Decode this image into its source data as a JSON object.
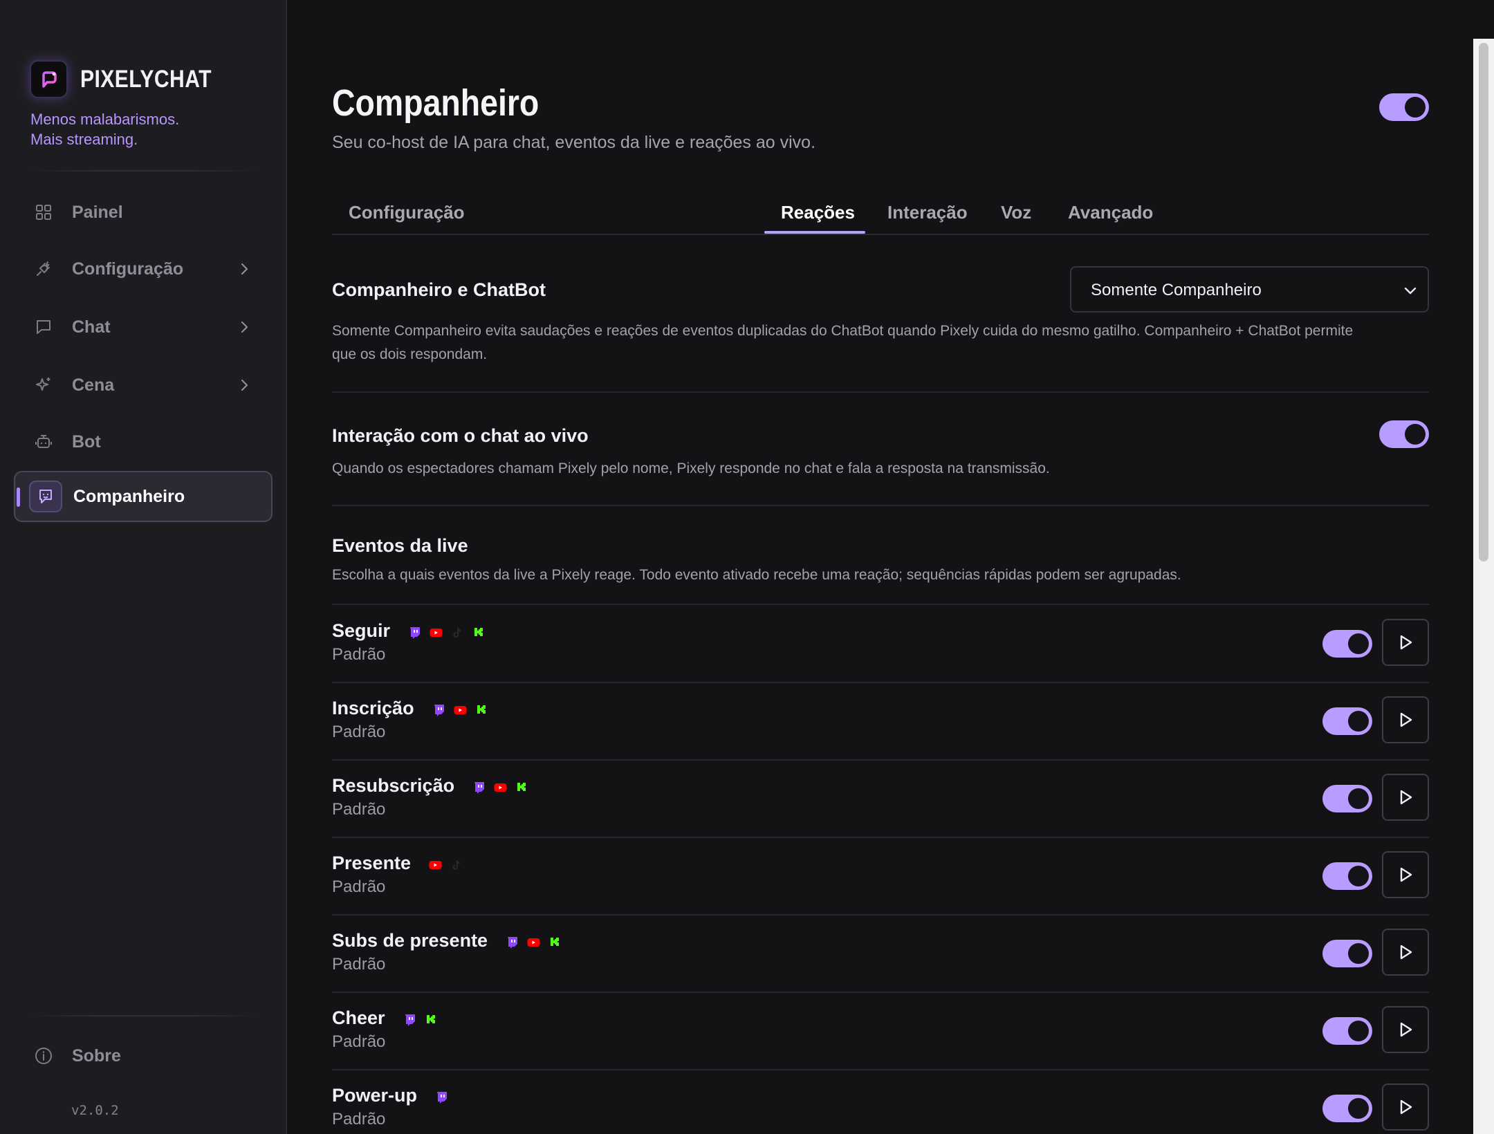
{
  "sidebar": {
    "brand": "PIXELYCHAT",
    "tagline_line1": "Menos malabarismos.",
    "tagline_line2": "Mais streaming.",
    "items": [
      {
        "label": "Painel",
        "icon": "grid-icon"
      },
      {
        "label": "Configuração",
        "icon": "plug-icon"
      },
      {
        "label": "Chat",
        "icon": "chat-bubble-icon"
      },
      {
        "label": "Cena",
        "icon": "sparkle-icon"
      },
      {
        "label": "Bot",
        "icon": "robot-icon"
      },
      {
        "label": "Companheiro",
        "icon": "companion-icon"
      }
    ],
    "about_label": "Sobre",
    "version": "v2.0.2"
  },
  "page": {
    "title": "Companheiro",
    "subtitle": "Seu co-host de IA para chat, eventos da live e reações ao vivo.",
    "enabled": true
  },
  "tabs": [
    "Configuração",
    "Reações",
    "Interação",
    "Voz",
    "Avançado"
  ],
  "active_tab": "Reações",
  "sections": {
    "companion_chatbot": {
      "title": "Companheiro e ChatBot",
      "select_value": "Somente Companheiro",
      "desc_line1": "Somente Companheiro evita saudações e reações de eventos duplicadas do ChatBot quando Pixely cuida do mesmo gatilho. Companheiro + ChatBot permite",
      "desc_line2": "que os dois respondam."
    },
    "live_chat": {
      "title": "Interação com o chat ao vivo",
      "desc": "Quando os espectadores chamam Pixely pelo nome, Pixely responde no chat e fala a resposta na transmissão.",
      "enabled": true
    },
    "live_events": {
      "title": "Eventos da live",
      "desc": "Escolha a quais eventos da live a Pixely reage. Todo evento ativado recebe uma reação; sequências rápidas podem ser agrupadas."
    }
  },
  "events": [
    {
      "name": "Seguir",
      "sub": "Padrão",
      "platforms": [
        "twitch",
        "youtube",
        "tiktok",
        "kick"
      ],
      "enabled": true
    },
    {
      "name": "Inscrição",
      "sub": "Padrão",
      "platforms": [
        "twitch",
        "youtube",
        "kick"
      ],
      "enabled": true
    },
    {
      "name": "Resubscrição",
      "sub": "Padrão",
      "platforms": [
        "twitch",
        "youtube",
        "kick"
      ],
      "enabled": true
    },
    {
      "name": "Presente",
      "sub": "Padrão",
      "platforms": [
        "youtube",
        "tiktok"
      ],
      "enabled": true
    },
    {
      "name": "Subs de presente",
      "sub": "Padrão",
      "platforms": [
        "twitch",
        "youtube",
        "kick"
      ],
      "enabled": true
    },
    {
      "name": "Cheer",
      "sub": "Padrão",
      "platforms": [
        "twitch",
        "kick"
      ],
      "enabled": true
    },
    {
      "name": "Power-up",
      "sub": "Padrão",
      "platforms": [
        "twitch"
      ],
      "enabled": true
    }
  ],
  "colors": {
    "accent": "#b89cff",
    "twitch": "#9146ff",
    "youtube": "#ff0000",
    "tiktok": "#2a2a2a",
    "kick": "#53fc18"
  }
}
